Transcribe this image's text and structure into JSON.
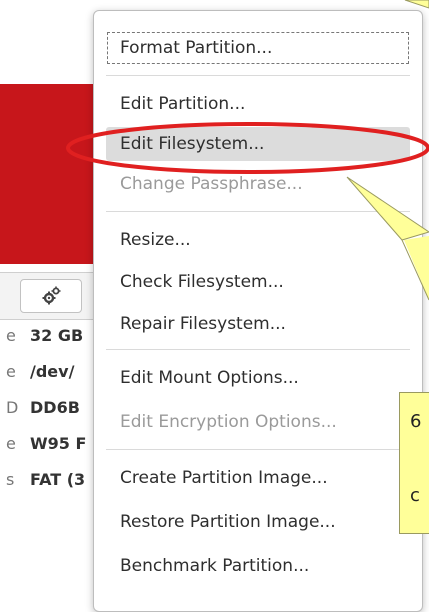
{
  "window": {
    "properties": [
      {
        "key": "e",
        "value": "32 GB"
      },
      {
        "key": "e",
        "value": "/dev/"
      },
      {
        "key": "D",
        "value": "DD6B"
      },
      {
        "key": "e",
        "value": "W95 F"
      },
      {
        "key": "s",
        "value": "FAT (3"
      }
    ]
  },
  "menu": {
    "items": [
      {
        "label": "Format Partition...",
        "state": "focused"
      },
      {
        "label": "Edit Partition...",
        "state": "normal"
      },
      {
        "label": "Edit Filesystem...",
        "state": "hover"
      },
      {
        "label": "Change Passphrase...",
        "state": "disabled"
      },
      {
        "label": "Resize...",
        "state": "normal"
      },
      {
        "label": "Check Filesystem...",
        "state": "normal"
      },
      {
        "label": "Repair Filesystem...",
        "state": "normal"
      },
      {
        "label": "Edit Mount Options...",
        "state": "normal"
      },
      {
        "label": "Edit Encryption Options...",
        "state": "disabled"
      },
      {
        "label": "Create Partition Image...",
        "state": "normal"
      },
      {
        "label": "Restore Partition Image...",
        "state": "normal"
      },
      {
        "label": "Benchmark Partition...",
        "state": "normal"
      }
    ]
  },
  "callout": {
    "text_lines": [
      "6",
      "c"
    ]
  },
  "colors": {
    "accent_red": "#c7161b",
    "highlight_ellipse": "#e02020",
    "callout_fill": "#ffff99"
  }
}
